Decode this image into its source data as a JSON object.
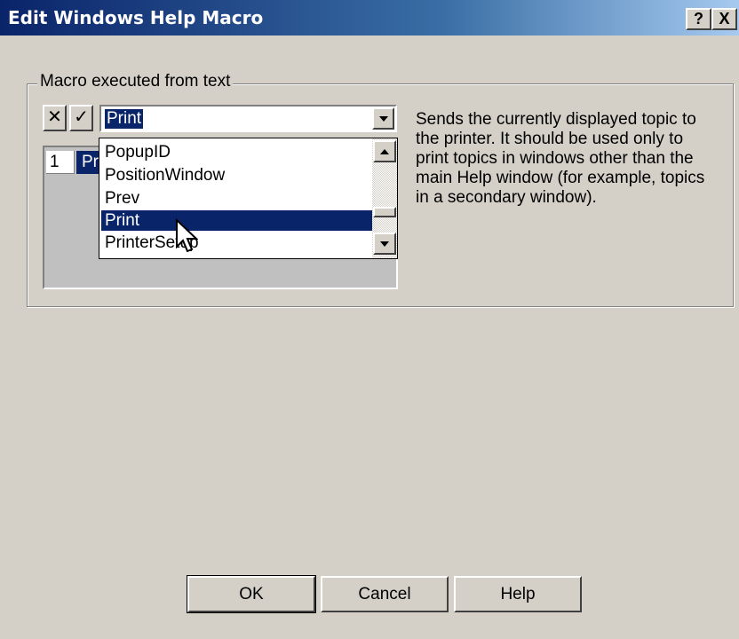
{
  "window": {
    "title": "Edit Windows Help Macro",
    "help_button": "?",
    "close_button": "X"
  },
  "group": {
    "label": "Macro executed from text"
  },
  "toolbar": {
    "cancel_symbol": "✕",
    "accept_symbol": "✓"
  },
  "combo": {
    "value": "Print"
  },
  "grid": {
    "row_number": "1",
    "cell_value": "Pr"
  },
  "dropdown": {
    "items": [
      "PopupID",
      "PositionWindow",
      "Prev",
      "Print",
      "PrinterSetup"
    ],
    "selected": "Print"
  },
  "description": "Sends the currently displayed topic to the printer. It should be used only to print topics in windows other than the main Help window (for example, topics in a secondary window).",
  "buttons": {
    "ok": "OK",
    "cancel": "Cancel",
    "help": "Help"
  },
  "colors": {
    "face": "#d4d0c8",
    "selection": "#0a246a",
    "title_start": "#0a246a"
  }
}
